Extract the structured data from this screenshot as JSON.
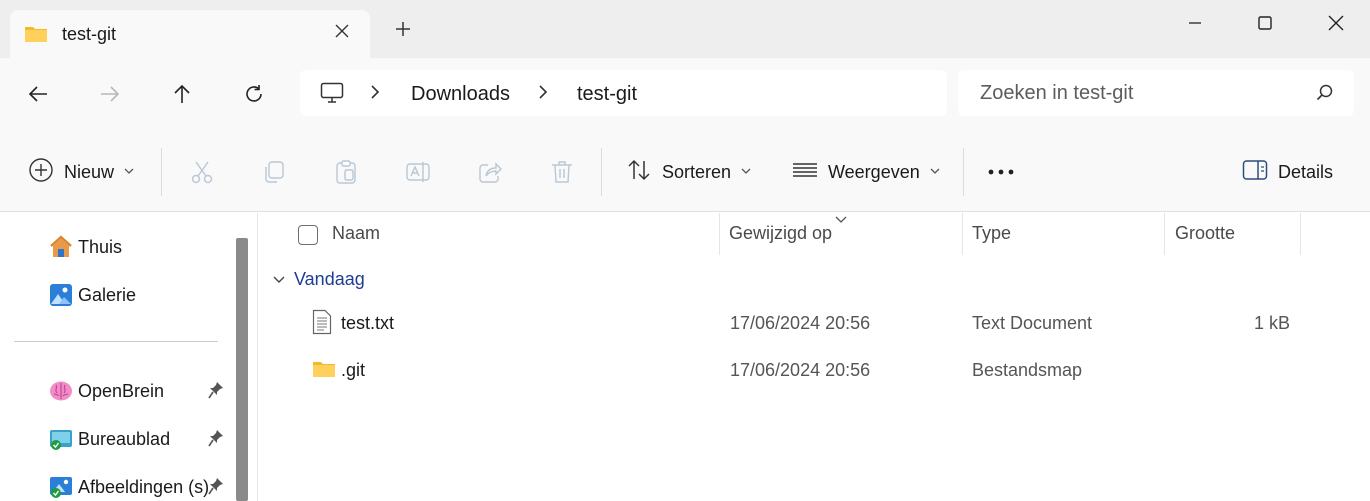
{
  "window": {
    "tab_title": "test-git",
    "close_tab_icon": "close-icon",
    "new_tab_icon": "plus-icon",
    "controls": [
      "minimize-icon",
      "maximize-icon",
      "close-icon"
    ]
  },
  "navigation": {
    "buttons": [
      "back-arrow-icon",
      "forward-arrow-icon",
      "up-arrow-icon",
      "refresh-icon"
    ]
  },
  "address": {
    "root_icon": "computer-icon",
    "crumbs": [
      "Downloads",
      "test-git"
    ]
  },
  "search": {
    "placeholder": "Zoeken in test-git",
    "icon": "search-icon"
  },
  "toolbar": {
    "new_label": "Nieuw",
    "sort_label": "Sorteren",
    "view_label": "Weergeven",
    "details_label": "Details",
    "icons": [
      "cut-icon",
      "copy-icon",
      "paste-icon",
      "rename-icon",
      "share-icon",
      "delete-icon",
      "more-icon"
    ]
  },
  "sidebar": {
    "items": [
      {
        "label": "Thuis",
        "icon": "home-icon"
      },
      {
        "label": "Galerie",
        "icon": "gallery-icon"
      },
      {
        "label": "OpenBrein",
        "icon": "brain-icon",
        "pinned": true
      },
      {
        "label": "Bureaublad",
        "icon": "desktop-folder-icon",
        "pinned": true
      },
      {
        "label": "Afbeeldingen (s)",
        "icon": "pictures-folder-icon",
        "pinned": true
      }
    ]
  },
  "files": {
    "columns": [
      "Naam",
      "Gewijzigd op",
      "Type",
      "Grootte"
    ],
    "group_label": "Vandaag",
    "rows": [
      {
        "name": "test.txt",
        "modified": "17/06/2024 20:56",
        "type": "Text Document",
        "size": "1 kB",
        "icon": "text-file-icon"
      },
      {
        "name": ".git",
        "modified": "17/06/2024 20:56",
        "type": "Bestandsmap",
        "size": "",
        "icon": "folder-icon"
      }
    ]
  },
  "colors": {
    "folder": "#ffd15c",
    "accent": "#1f3d91",
    "scrollbar": "#8a8a8a"
  }
}
